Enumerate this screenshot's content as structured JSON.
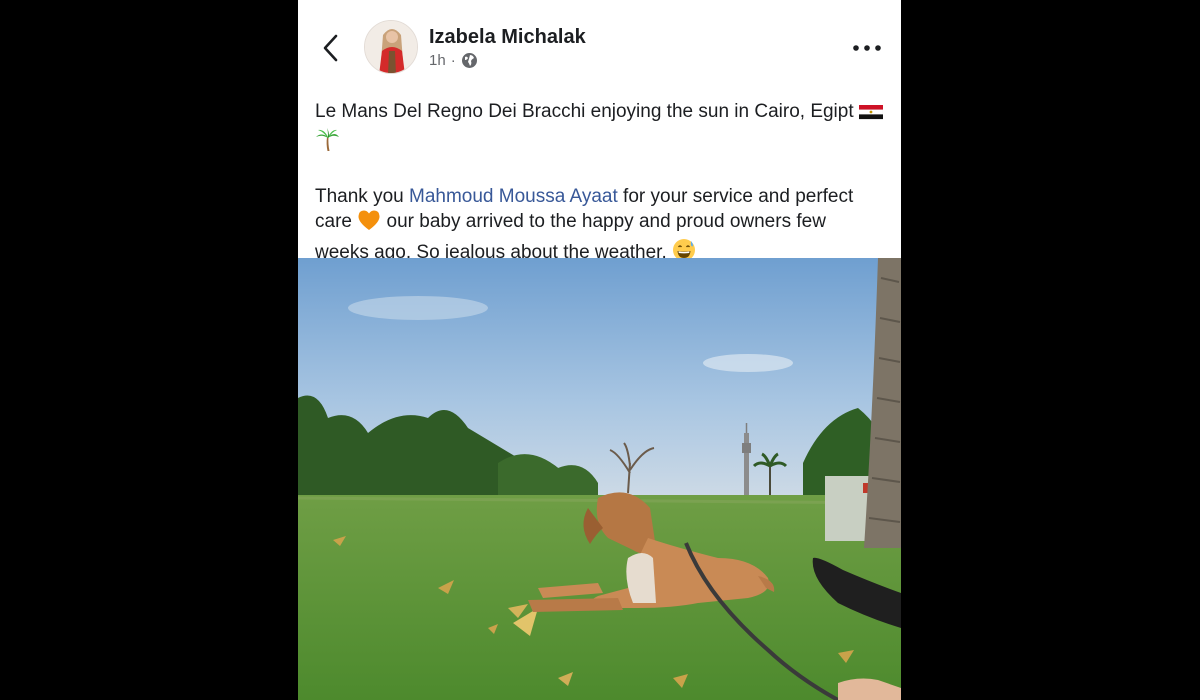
{
  "post": {
    "author": "Izabela Michalak",
    "time": "1h",
    "separator": "·",
    "caption_line1": "Le Mans Del Regno Dei Bracchi enjoying the sun in Cairo, Egipt",
    "caption_p2_before": "Thank you ",
    "mention": "Mahmoud Moussa Ayaat",
    "caption_p2_mid": " for your service and perfect care",
    "caption_p2_after": " our baby arrived to the happy and proud owners few weeks ago. So jealous about the weather.",
    "emojis": [
      "egypt-flag",
      "palm-tree",
      "orange-heart",
      "grinning-sweat-face"
    ]
  },
  "colors": {
    "mention": "#385898",
    "author_text": "#1c1e21",
    "meta_text": "#65676b",
    "background": "#000000",
    "card": "#ffffff"
  },
  "icons": [
    "back-chevron-icon",
    "globe-icon",
    "more-options-icon"
  ]
}
